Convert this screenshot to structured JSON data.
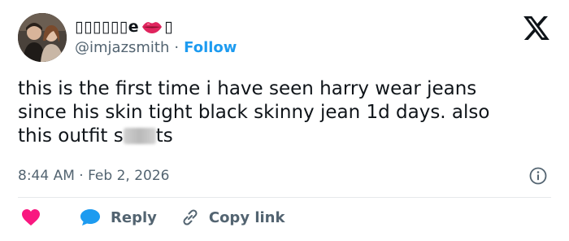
{
  "author": {
    "display_name": "▯▯▯▯▯▯e",
    "name_tail": "▯",
    "emoji_icon": "kiss-mark-lips-icon",
    "handle": "@imjazsmith",
    "separator": "·",
    "follow_label": "Follow"
  },
  "tweet": {
    "text_before": "this is the first time i have seen harry wear jeans\nsince his skin tight black skinny jean 1d days. also\nthis outfit s",
    "text_after": "ts"
  },
  "meta": {
    "timestamp": "8:44 AM · Feb 2, 2026"
  },
  "actions": {
    "reply_label": "Reply",
    "copy_label": "Copy link"
  },
  "colors": {
    "accent": "#1d9bf0",
    "like": "#f91880",
    "reply": "#1d9bf0",
    "muted": "#536471",
    "text": "#0f1419"
  },
  "icons": [
    "x-logo-icon",
    "info-icon",
    "heart-icon",
    "reply-bubble-icon",
    "link-icon"
  ]
}
